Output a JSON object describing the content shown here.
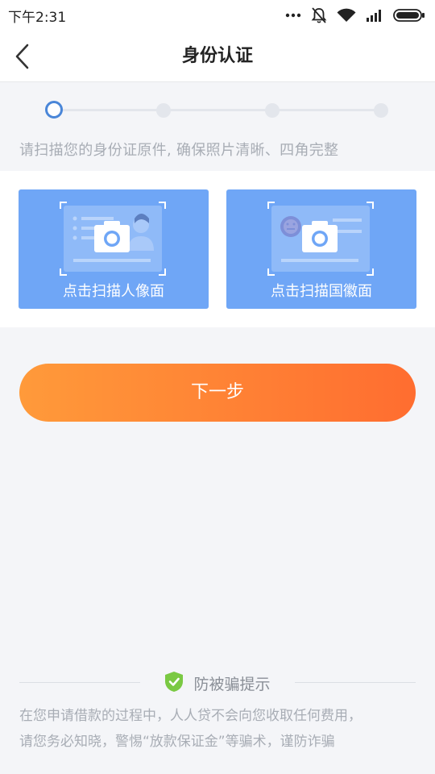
{
  "status_bar": {
    "time": "下午2:31",
    "icons": [
      "more-dots-icon",
      "bell-muted-icon",
      "wifi-icon",
      "signal-icon",
      "battery-icon"
    ]
  },
  "header": {
    "title": "身份认证",
    "back_icon": "chevron-left-icon"
  },
  "steps": {
    "count": 4,
    "current": 1
  },
  "instruction": "请扫描您的身份证原件, 确保照片清晰、四角完整",
  "id_cards": {
    "front_label": "点击扫描人像面",
    "back_label": "点击扫描国徽面",
    "background_color": "#6fa6f6"
  },
  "next_button": {
    "label": "下一步",
    "gradient": [
      "#ff9a3a",
      "#ff6d30"
    ]
  },
  "fraud_tips": {
    "title": "防被骗提示",
    "icon": "shield-check-icon",
    "line1": "在您申请借款的过程中，人人贷不会向您收取任何费用，",
    "line2": "请您务必知晓，警惕“放款保证金”等骗术，谨防诈骗"
  },
  "colors": {
    "accent_blue": "#4a86d8",
    "shield_green": "#7ac943",
    "page_bg": "#f4f5f8"
  }
}
